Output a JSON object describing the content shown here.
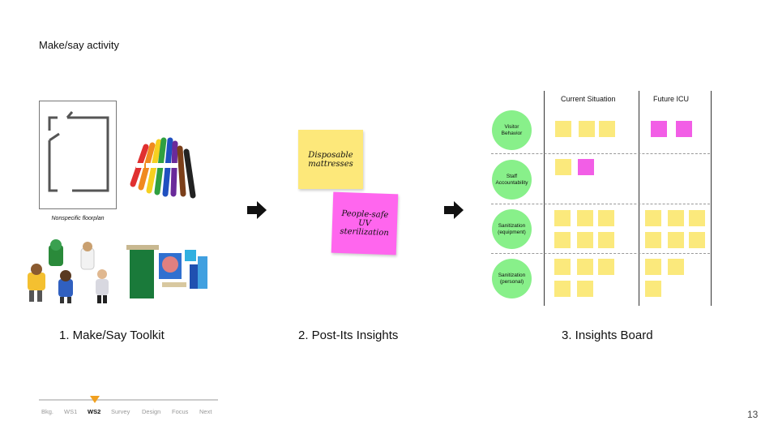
{
  "slide": {
    "title": "Make/say activity",
    "page_number": "13"
  },
  "toolkit": {
    "floorplan_caption": "Nonspecific floorplan",
    "label": "1. Make/Say Toolkit"
  },
  "postits": {
    "label": "2. Post-Its Insights",
    "yellow_text": "Disposable mattresses",
    "pink_text": "People-safe UV sterilization"
  },
  "board": {
    "label": "3. Insights Board",
    "columns": [
      "Current Situation",
      "Future ICU"
    ],
    "rows": [
      "Visitor Behavior",
      "Staff Accountability",
      "Sanitization (equipment)",
      "Sanitization (personal)"
    ]
  },
  "nav": {
    "items": [
      "Bkg.",
      "WS1",
      "WS2",
      "Survey",
      "Design",
      "Focus",
      "Next"
    ],
    "active": "WS2"
  },
  "colors": {
    "sticky_yellow": "#fde87a",
    "sticky_pink": "#ff66ee",
    "circle_green": "#88f08a",
    "progress_marker": "#f0a020"
  }
}
